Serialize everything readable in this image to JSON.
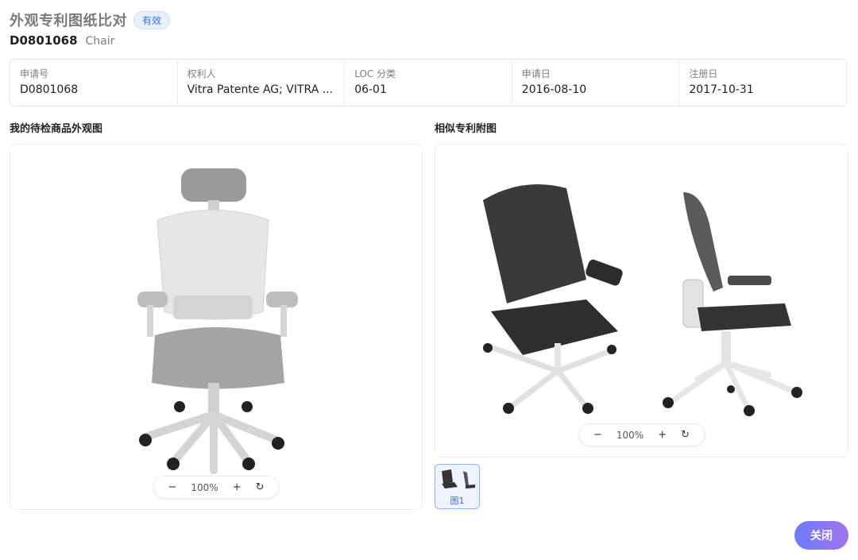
{
  "header": {
    "title": "外观专利图纸比对",
    "status_badge": "有效",
    "patent_number": "D0801068",
    "product_name": "Chair"
  },
  "info": [
    {
      "label": "申请号",
      "value": "D0801068"
    },
    {
      "label": "权利人",
      "value": "Vitra Patente AG; VITRA ..."
    },
    {
      "label": "LOC 分类",
      "value": "06-01"
    },
    {
      "label": "申请日",
      "value": "2016-08-10"
    },
    {
      "label": "注册日",
      "value": "2017-10-31"
    }
  ],
  "left_panel": {
    "title": "我的待检商品外观图",
    "zoom": {
      "minus": "−",
      "value": "100%",
      "plus": "+",
      "reset": "↻"
    }
  },
  "right_panel": {
    "title": "相似专利附图",
    "zoom": {
      "minus": "−",
      "value": "100%",
      "plus": "+",
      "reset": "↻"
    },
    "thumbnails": [
      {
        "label": "图1"
      }
    ]
  },
  "footer": {
    "close_label": "关闭"
  },
  "colors": {
    "accent": "#3b6fd9",
    "close_gradient_start": "#6b7df7",
    "close_gradient_end": "#a172f0"
  }
}
